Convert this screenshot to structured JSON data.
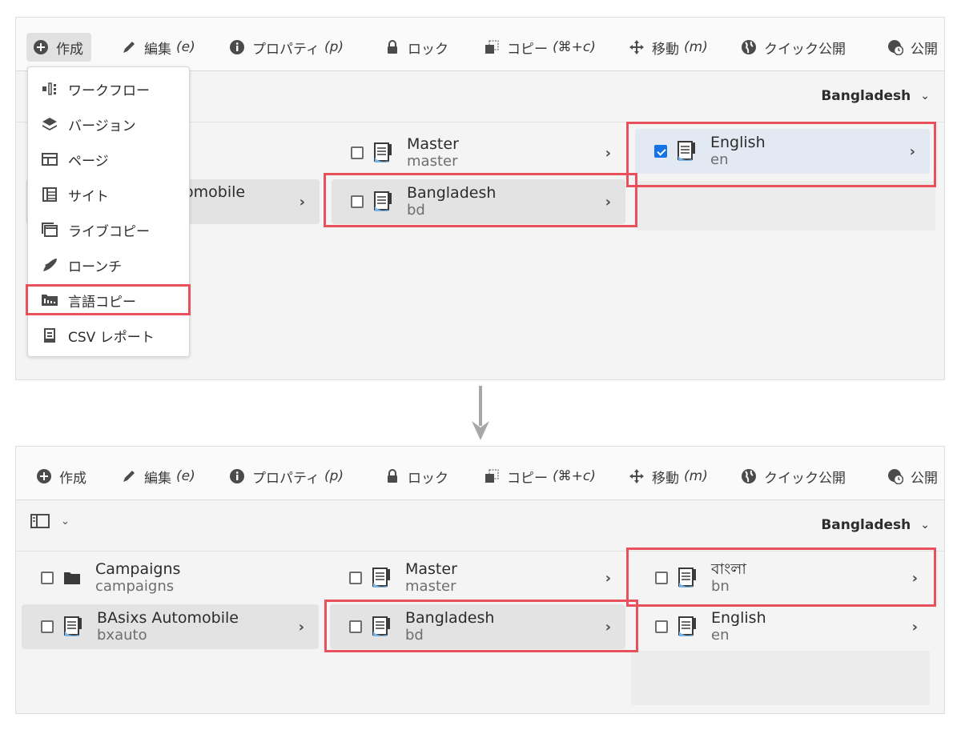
{
  "toolbar": {
    "create": "作成",
    "edit": "編集",
    "edit_key": "(e)",
    "properties": "プロパティ",
    "properties_key": "(p)",
    "lock": "ロック",
    "copy": "コピー",
    "copy_key": "(⌘+c)",
    "move": "移動",
    "move_key": "(m)",
    "quick_publish": "クイック公開",
    "publish": "公開"
  },
  "create_menu": {
    "items": [
      "ワークフロー",
      "バージョン",
      "ページ",
      "サイト",
      "ライブコピー",
      "ローンチ",
      "言語コピー",
      "CSV レポート"
    ]
  },
  "location": "Bangladesh",
  "top": {
    "col1_partial": "omobile",
    "col2": [
      {
        "title": "Master",
        "name": "master"
      },
      {
        "title": "Bangladesh",
        "name": "bd"
      }
    ],
    "col3": [
      {
        "title": "English",
        "name": "en"
      }
    ]
  },
  "bottom": {
    "col1": [
      {
        "title": "Campaigns",
        "name": "campaigns"
      },
      {
        "title": "BAsixs Automobile",
        "name": "bxauto"
      }
    ],
    "col2": [
      {
        "title": "Master",
        "name": "master"
      },
      {
        "title": "Bangladesh",
        "name": "bd"
      }
    ],
    "col3": [
      {
        "title": "বাংলা",
        "name": "bn"
      },
      {
        "title": "English",
        "name": "en"
      }
    ]
  },
  "colors": {
    "highlight": "#e8505b",
    "checkbox_blue": "#1473e6"
  }
}
